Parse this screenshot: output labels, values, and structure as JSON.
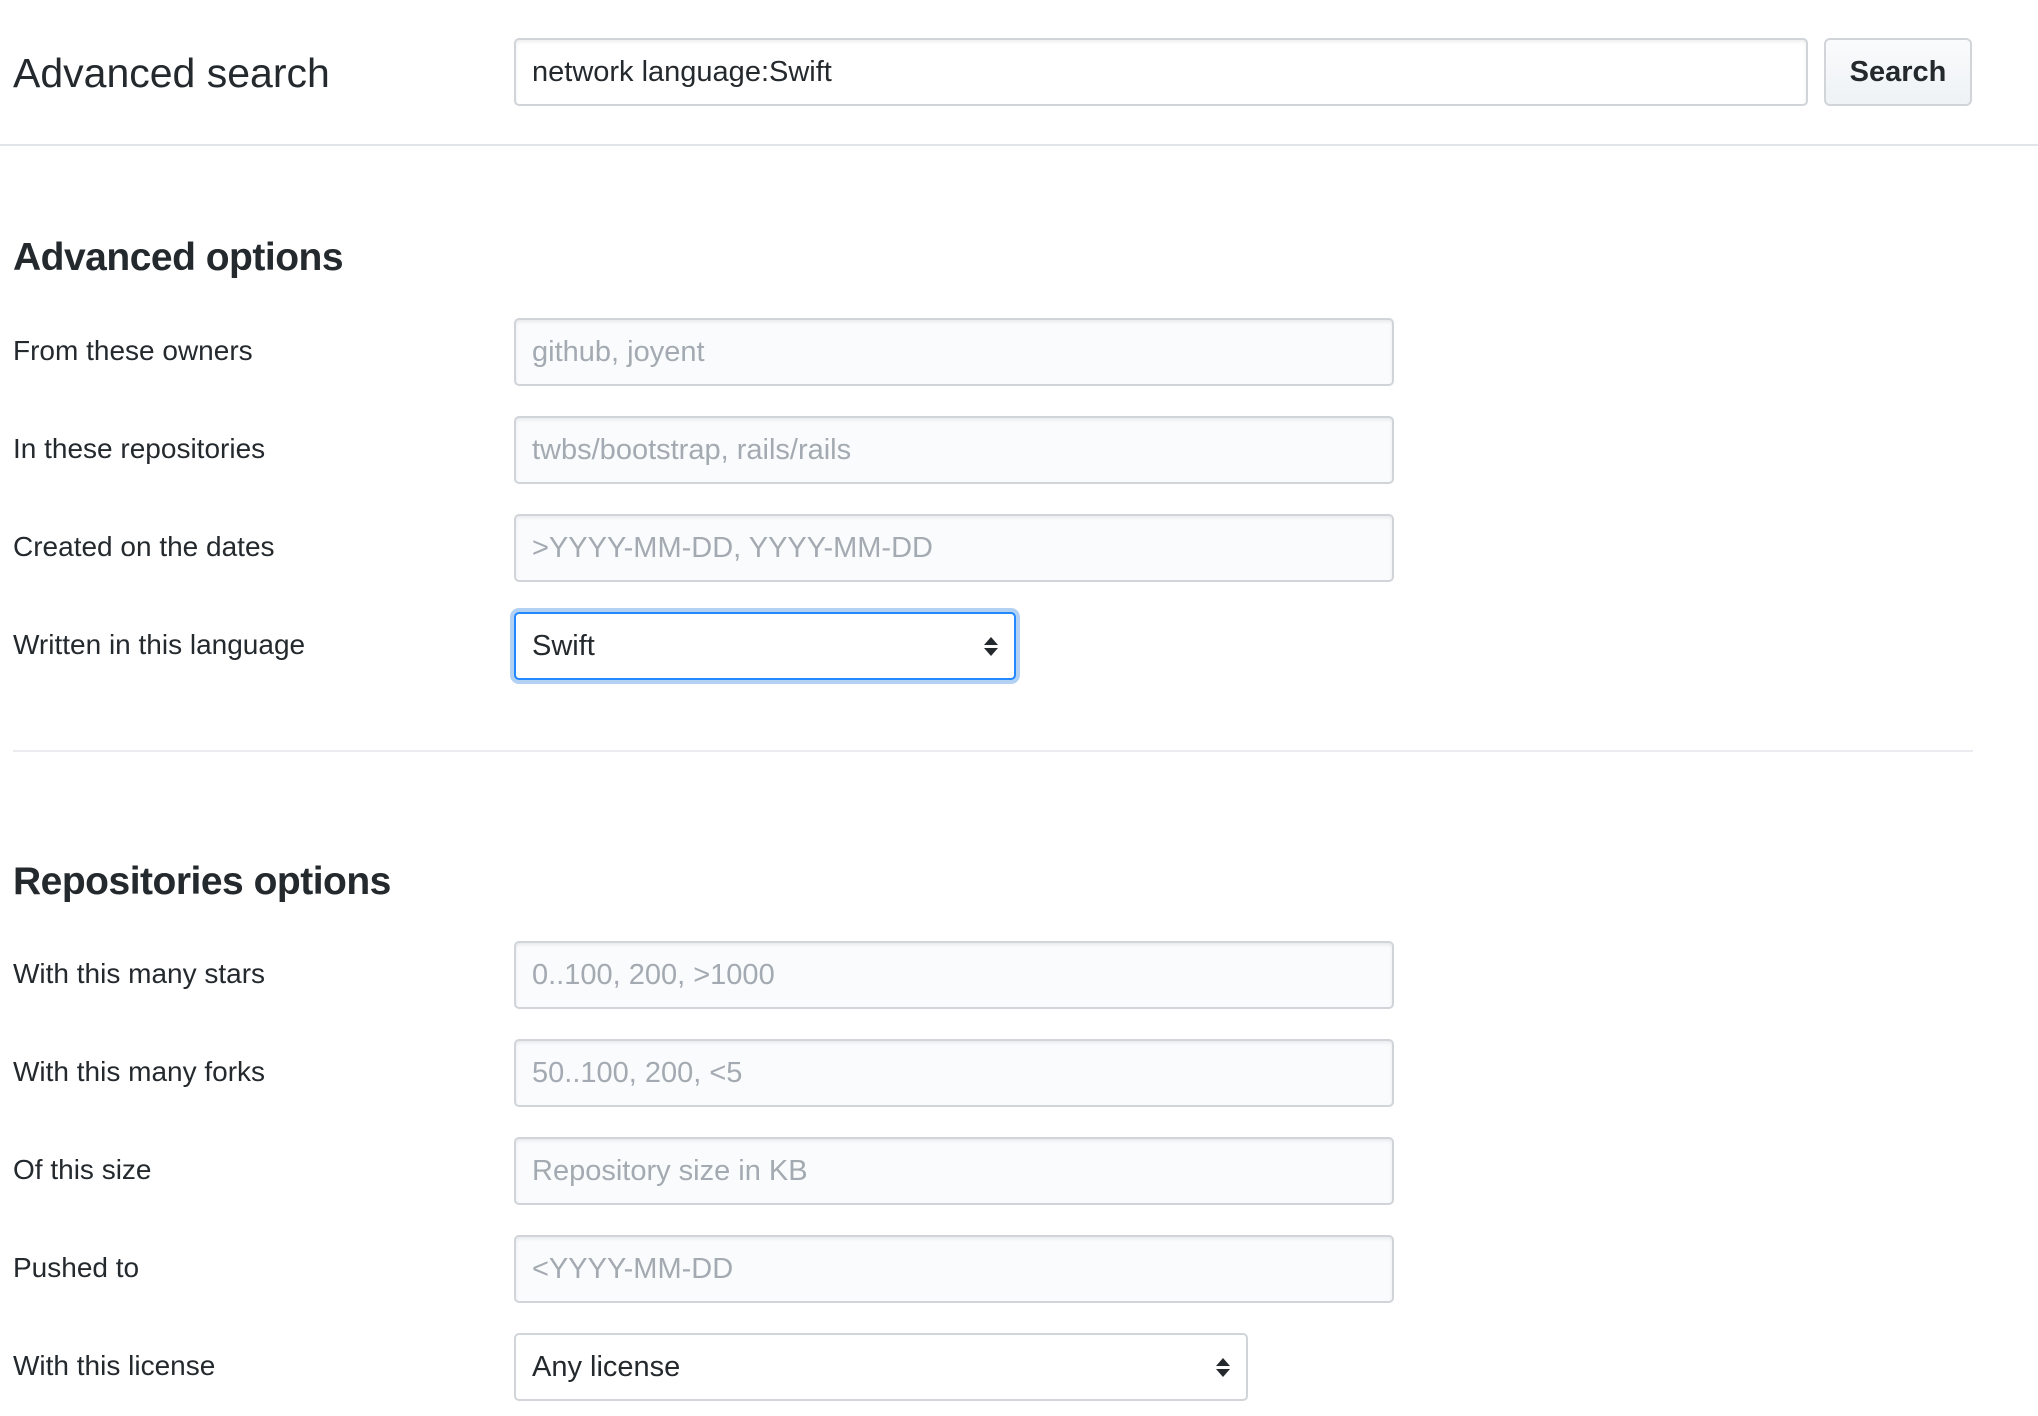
{
  "header": {
    "title": "Advanced search",
    "search_value": "network language:Swift",
    "search_button_label": "Search"
  },
  "advanced_options": {
    "heading": "Advanced options",
    "owners": {
      "label": "From these owners",
      "placeholder": "github, joyent"
    },
    "repositories": {
      "label": "In these repositories",
      "placeholder": "twbs/bootstrap, rails/rails"
    },
    "dates": {
      "label": "Created on the dates",
      "placeholder": ">YYYY-MM-DD, YYYY-MM-DD"
    },
    "language": {
      "label": "Written in this language",
      "selected": "Swift"
    }
  },
  "repositories_options": {
    "heading": "Repositories options",
    "stars": {
      "label": "With this many stars",
      "placeholder": "0..100, 200, >1000"
    },
    "forks": {
      "label": "With this many forks",
      "placeholder": "50..100, 200, <5"
    },
    "size": {
      "label": "Of this size",
      "placeholder": "Repository size in KB"
    },
    "pushed": {
      "label": "Pushed to",
      "placeholder": "<YYYY-MM-DD"
    },
    "license": {
      "label": "With this license",
      "selected": "Any license"
    }
  },
  "colors": {
    "focus_border": "#2188ff",
    "text": "#24292e",
    "placeholder": "#a3aab1",
    "input_border": "#d1d5da"
  },
  "icons": {
    "select_arrows": "chevron-up-down-icon"
  }
}
